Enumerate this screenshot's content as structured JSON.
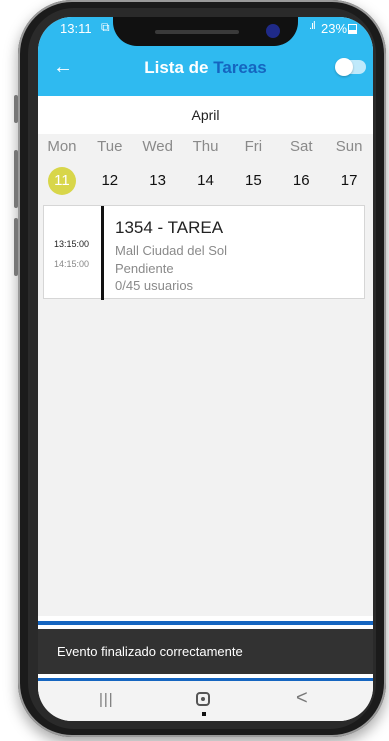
{
  "status_bar": {
    "time": "13:11",
    "notification_icon": "screenshot-icon",
    "signal": ".ıl",
    "battery": "23%"
  },
  "app_bar": {
    "back_icon": "back-arrow-icon",
    "title_part1": "Lista de",
    "title_part2": "Tareas",
    "toggle_state": "off"
  },
  "calendar": {
    "month": "April",
    "days": [
      {
        "name": "Mon",
        "num": "11",
        "selected": true
      },
      {
        "name": "Tue",
        "num": "12"
      },
      {
        "name": "Wed",
        "num": "13"
      },
      {
        "name": "Thu",
        "num": "14"
      },
      {
        "name": "Fri",
        "num": "15"
      },
      {
        "name": "Sat",
        "num": "16"
      },
      {
        "name": "Sun",
        "num": "17"
      }
    ],
    "selected_color": "#d8d64a"
  },
  "event": {
    "start": "13:15:00",
    "end": "14:15:00",
    "title": "1354 - TAREA",
    "place": "Mall Ciudad del Sol",
    "status": "Pendiente",
    "users": "0/45 usuarios"
  },
  "snackbar": {
    "message": "Evento finalizado correctamente"
  },
  "nav_bar": {
    "recent": "|||",
    "back": "<"
  },
  "colors": {
    "primary": "#2fbaf0",
    "accent": "#1565c0"
  }
}
